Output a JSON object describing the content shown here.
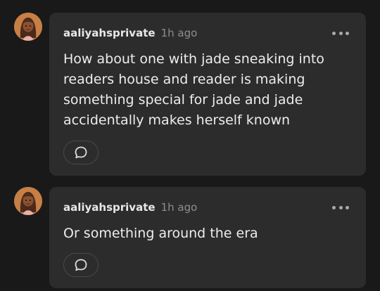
{
  "comments": [
    {
      "username": "aaliyahsprivate",
      "timestamp": "1h ago",
      "text": "How about one with jade sneaking into readers house and reader is making something special for jade and jade accidentally makes herself known",
      "avatar_icon": "avatar-cartoon-girl",
      "more_icon": "more-dots-icon",
      "reply_icon": "speech-bubble-icon"
    },
    {
      "username": "aaliyahsprivate",
      "timestamp": "1h ago",
      "text": "Or something around the era",
      "avatar_icon": "avatar-cartoon-girl",
      "more_icon": "more-dots-icon",
      "reply_icon": "speech-bubble-icon"
    }
  ],
  "colors": {
    "background": "#191919",
    "card": "#2c2c2c",
    "username": "#e8e8e8",
    "timestamp": "#8e8e8e",
    "body_text": "#ededed"
  }
}
